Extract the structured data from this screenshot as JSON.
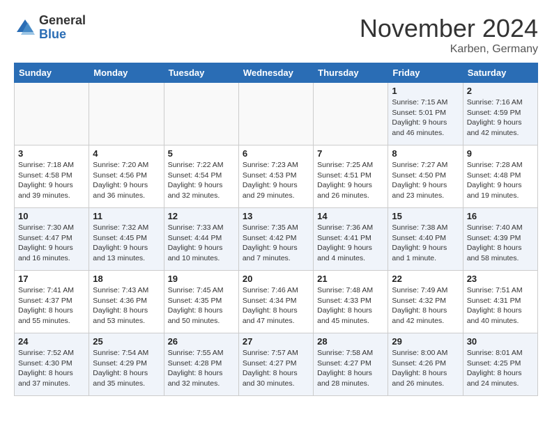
{
  "logo": {
    "general": "General",
    "blue": "Blue"
  },
  "header": {
    "month": "November 2024",
    "location": "Karben, Germany"
  },
  "weekdays": [
    "Sunday",
    "Monday",
    "Tuesday",
    "Wednesday",
    "Thursday",
    "Friday",
    "Saturday"
  ],
  "weeks": [
    [
      {
        "day": "",
        "info": ""
      },
      {
        "day": "",
        "info": ""
      },
      {
        "day": "",
        "info": ""
      },
      {
        "day": "",
        "info": ""
      },
      {
        "day": "",
        "info": ""
      },
      {
        "day": "1",
        "info": "Sunrise: 7:15 AM\nSunset: 5:01 PM\nDaylight: 9 hours and 46 minutes."
      },
      {
        "day": "2",
        "info": "Sunrise: 7:16 AM\nSunset: 4:59 PM\nDaylight: 9 hours and 42 minutes."
      }
    ],
    [
      {
        "day": "3",
        "info": "Sunrise: 7:18 AM\nSunset: 4:58 PM\nDaylight: 9 hours and 39 minutes."
      },
      {
        "day": "4",
        "info": "Sunrise: 7:20 AM\nSunset: 4:56 PM\nDaylight: 9 hours and 36 minutes."
      },
      {
        "day": "5",
        "info": "Sunrise: 7:22 AM\nSunset: 4:54 PM\nDaylight: 9 hours and 32 minutes."
      },
      {
        "day": "6",
        "info": "Sunrise: 7:23 AM\nSunset: 4:53 PM\nDaylight: 9 hours and 29 minutes."
      },
      {
        "day": "7",
        "info": "Sunrise: 7:25 AM\nSunset: 4:51 PM\nDaylight: 9 hours and 26 minutes."
      },
      {
        "day": "8",
        "info": "Sunrise: 7:27 AM\nSunset: 4:50 PM\nDaylight: 9 hours and 23 minutes."
      },
      {
        "day": "9",
        "info": "Sunrise: 7:28 AM\nSunset: 4:48 PM\nDaylight: 9 hours and 19 minutes."
      }
    ],
    [
      {
        "day": "10",
        "info": "Sunrise: 7:30 AM\nSunset: 4:47 PM\nDaylight: 9 hours and 16 minutes."
      },
      {
        "day": "11",
        "info": "Sunrise: 7:32 AM\nSunset: 4:45 PM\nDaylight: 9 hours and 13 minutes."
      },
      {
        "day": "12",
        "info": "Sunrise: 7:33 AM\nSunset: 4:44 PM\nDaylight: 9 hours and 10 minutes."
      },
      {
        "day": "13",
        "info": "Sunrise: 7:35 AM\nSunset: 4:42 PM\nDaylight: 9 hours and 7 minutes."
      },
      {
        "day": "14",
        "info": "Sunrise: 7:36 AM\nSunset: 4:41 PM\nDaylight: 9 hours and 4 minutes."
      },
      {
        "day": "15",
        "info": "Sunrise: 7:38 AM\nSunset: 4:40 PM\nDaylight: 9 hours and 1 minute."
      },
      {
        "day": "16",
        "info": "Sunrise: 7:40 AM\nSunset: 4:39 PM\nDaylight: 8 hours and 58 minutes."
      }
    ],
    [
      {
        "day": "17",
        "info": "Sunrise: 7:41 AM\nSunset: 4:37 PM\nDaylight: 8 hours and 55 minutes."
      },
      {
        "day": "18",
        "info": "Sunrise: 7:43 AM\nSunset: 4:36 PM\nDaylight: 8 hours and 53 minutes."
      },
      {
        "day": "19",
        "info": "Sunrise: 7:45 AM\nSunset: 4:35 PM\nDaylight: 8 hours and 50 minutes."
      },
      {
        "day": "20",
        "info": "Sunrise: 7:46 AM\nSunset: 4:34 PM\nDaylight: 8 hours and 47 minutes."
      },
      {
        "day": "21",
        "info": "Sunrise: 7:48 AM\nSunset: 4:33 PM\nDaylight: 8 hours and 45 minutes."
      },
      {
        "day": "22",
        "info": "Sunrise: 7:49 AM\nSunset: 4:32 PM\nDaylight: 8 hours and 42 minutes."
      },
      {
        "day": "23",
        "info": "Sunrise: 7:51 AM\nSunset: 4:31 PM\nDaylight: 8 hours and 40 minutes."
      }
    ],
    [
      {
        "day": "24",
        "info": "Sunrise: 7:52 AM\nSunset: 4:30 PM\nDaylight: 8 hours and 37 minutes."
      },
      {
        "day": "25",
        "info": "Sunrise: 7:54 AM\nSunset: 4:29 PM\nDaylight: 8 hours and 35 minutes."
      },
      {
        "day": "26",
        "info": "Sunrise: 7:55 AM\nSunset: 4:28 PM\nDaylight: 8 hours and 32 minutes."
      },
      {
        "day": "27",
        "info": "Sunrise: 7:57 AM\nSunset: 4:27 PM\nDaylight: 8 hours and 30 minutes."
      },
      {
        "day": "28",
        "info": "Sunrise: 7:58 AM\nSunset: 4:27 PM\nDaylight: 8 hours and 28 minutes."
      },
      {
        "day": "29",
        "info": "Sunrise: 8:00 AM\nSunset: 4:26 PM\nDaylight: 8 hours and 26 minutes."
      },
      {
        "day": "30",
        "info": "Sunrise: 8:01 AM\nSunset: 4:25 PM\nDaylight: 8 hours and 24 minutes."
      }
    ]
  ]
}
